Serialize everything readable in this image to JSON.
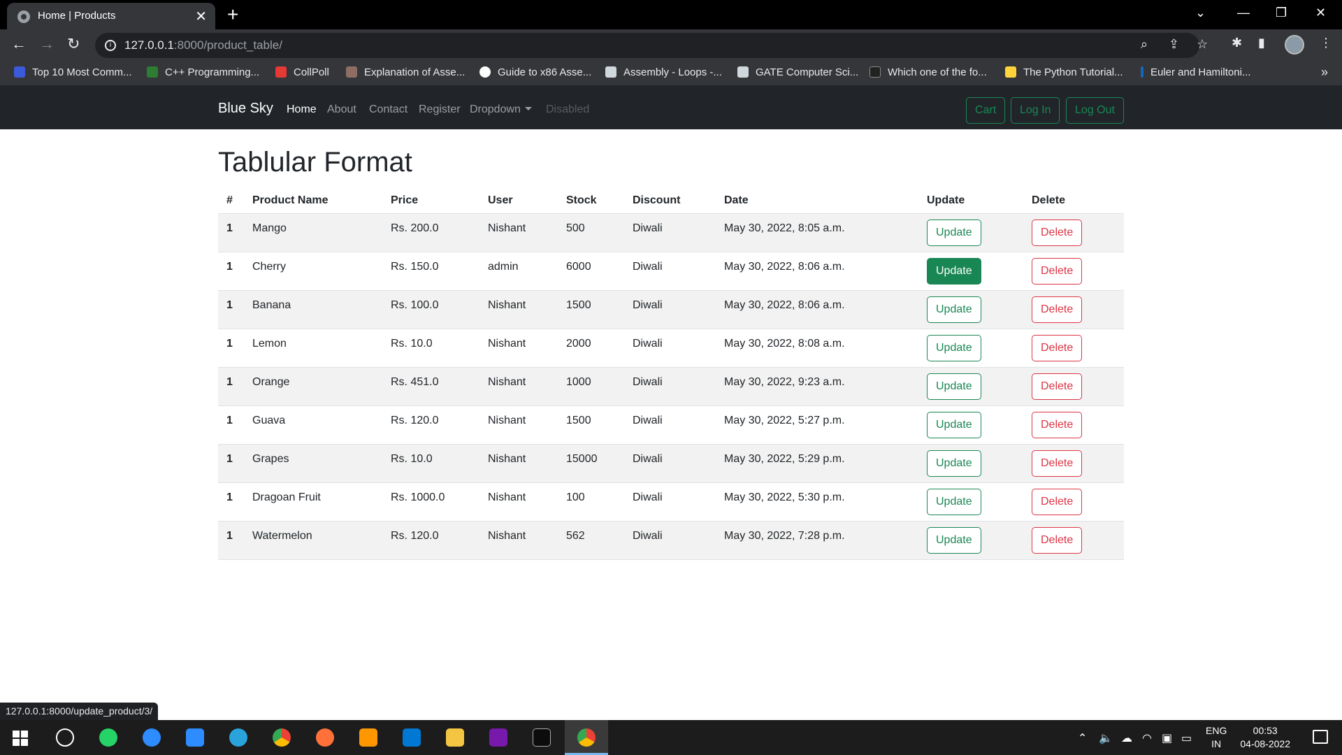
{
  "browser": {
    "tab_title": "Home | Products",
    "url_host": "127.0.0.1",
    "url_path": ":8000/product_table/",
    "status_url": "127.0.0.1:8000/update_product/3/"
  },
  "bookmarks": [
    {
      "label": "Top 10 Most Comm...",
      "icon_color": "#3b5bdb"
    },
    {
      "label": "C++ Programming...",
      "icon_color": "#2e7d32"
    },
    {
      "label": "CollPoll",
      "icon_color": "#e53935"
    },
    {
      "label": "Explanation of Asse...",
      "icon_color": "#8d6e63"
    },
    {
      "label": "Guide to x86 Asse...",
      "icon_color": "#ffffff"
    },
    {
      "label": "Assembly - Loops -...",
      "icon_color": "#cfd8dc"
    },
    {
      "label": "GATE Computer Sci...",
      "icon_color": "#cfd8dc"
    },
    {
      "label": "Which one of the fo...",
      "icon_color": "#222222"
    },
    {
      "label": "The Python Tutorial...",
      "icon_color": "#ffd43b"
    },
    {
      "label": "Euler and Hamiltoni...",
      "icon_color": "#1565c0"
    }
  ],
  "navbar": {
    "brand": "Blue Sky",
    "links": [
      "Home",
      "About",
      "Contact",
      "Register",
      "Dropdown",
      "Disabled"
    ],
    "buttons": [
      "Cart",
      "Log In",
      "Log Out"
    ]
  },
  "page": {
    "title": "Tablular Format",
    "columns": [
      "#",
      "Product Name",
      "Price",
      "User",
      "Stock",
      "Discount",
      "Date",
      "Update",
      "Delete"
    ],
    "update_label": "Update",
    "delete_label": "Delete",
    "rows": [
      {
        "num": "1",
        "name": "Mango",
        "price": "Rs. 200.0",
        "user": "Nishant",
        "stock": "500",
        "discount": "Diwali",
        "date": "May 30, 2022, 8:05 a.m."
      },
      {
        "num": "1",
        "name": "Cherry",
        "price": "Rs. 150.0",
        "user": "admin",
        "stock": "6000",
        "discount": "Diwali",
        "date": "May 30, 2022, 8:06 a.m."
      },
      {
        "num": "1",
        "name": "Banana",
        "price": "Rs. 100.0",
        "user": "Nishant",
        "stock": "1500",
        "discount": "Diwali",
        "date": "May 30, 2022, 8:06 a.m."
      },
      {
        "num": "1",
        "name": "Lemon",
        "price": "Rs. 10.0",
        "user": "Nishant",
        "stock": "2000",
        "discount": "Diwali",
        "date": "May 30, 2022, 8:08 a.m."
      },
      {
        "num": "1",
        "name": "Orange",
        "price": "Rs. 451.0",
        "user": "Nishant",
        "stock": "1000",
        "discount": "Diwali",
        "date": "May 30, 2022, 9:23 a.m."
      },
      {
        "num": "1",
        "name": "Guava",
        "price": "Rs. 120.0",
        "user": "Nishant",
        "stock": "1500",
        "discount": "Diwali",
        "date": "May 30, 2022, 5:27 p.m."
      },
      {
        "num": "1",
        "name": "Grapes",
        "price": "Rs. 10.0",
        "user": "Nishant",
        "stock": "15000",
        "discount": "Diwali",
        "date": "May 30, 2022, 5:29 p.m."
      },
      {
        "num": "1",
        "name": "Dragoan Fruit",
        "price": "Rs. 1000.0",
        "user": "Nishant",
        "stock": "100",
        "discount": "Diwali",
        "date": "May 30, 2022, 5:30 p.m."
      },
      {
        "num": "1",
        "name": "Watermelon",
        "price": "Rs. 120.0",
        "user": "Nishant",
        "stock": "562",
        "discount": "Diwali",
        "date": "May 30, 2022, 7:28 p.m."
      }
    ]
  },
  "taskbar": {
    "lang": "ENG",
    "region": "IN",
    "time": "00:53",
    "date": "04-08-2022"
  }
}
